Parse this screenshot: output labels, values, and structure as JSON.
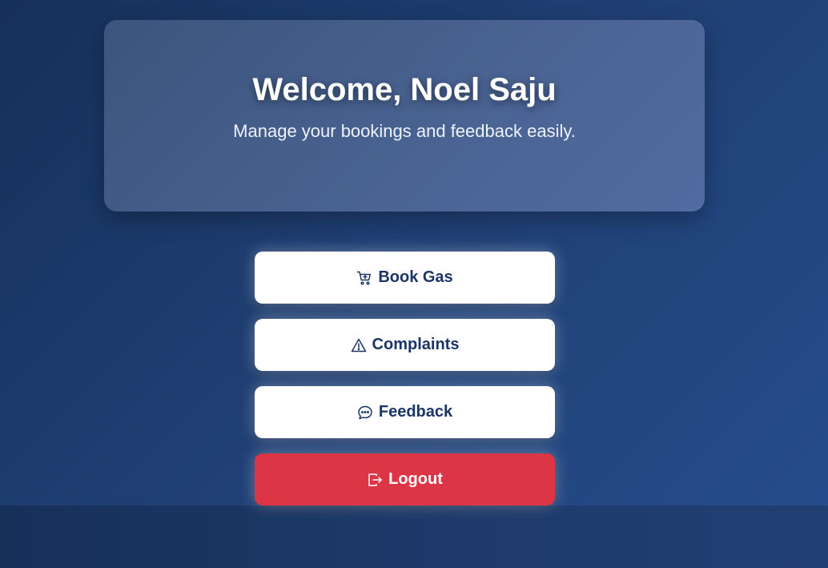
{
  "hero": {
    "title": "Welcome, Noel Saju",
    "subtitle": "Manage your bookings and feedback easily."
  },
  "actions": {
    "book_gas": {
      "label": "Book Gas",
      "icon": "cart-plus-icon"
    },
    "complaints": {
      "label": "Complaints",
      "icon": "warning-triangle-icon"
    },
    "feedback": {
      "label": "Feedback",
      "icon": "chat-dots-icon"
    },
    "logout": {
      "label": "Logout",
      "icon": "logout-icon"
    }
  },
  "colors": {
    "primary_text": "#1b3566",
    "danger": "#dc3545",
    "background": "#1f3f73"
  }
}
